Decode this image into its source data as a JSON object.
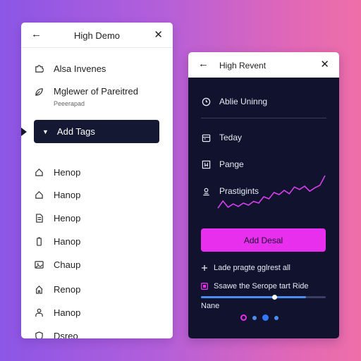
{
  "left_panel": {
    "title": "High Demo",
    "items": [
      {
        "label": "Alsa Invenes",
        "icon": "puzzle-icon"
      },
      {
        "label": "Mglewer of Pareitred",
        "sublabel": "Peeerapad",
        "icon": "leaf-icon"
      },
      {
        "label": "Add Tags",
        "icon": "caret-down-icon",
        "selected": true
      },
      {
        "label": "Henop",
        "icon": "house-icon"
      },
      {
        "label": "Hanop",
        "icon": "house-icon"
      },
      {
        "label": "Henop",
        "icon": "document-icon"
      },
      {
        "label": "Hanop",
        "icon": "battery-icon"
      },
      {
        "label": "Chaup",
        "icon": "image-icon"
      },
      {
        "label": "Renop",
        "icon": "home-outline-icon"
      },
      {
        "label": "Hanop",
        "icon": "person-icon"
      },
      {
        "label": "Dsreo",
        "icon": "shield-icon"
      }
    ]
  },
  "right_panel": {
    "title": "High Revent",
    "rows": [
      {
        "label": "Ablie Uninng",
        "icon": "clock-icon"
      },
      {
        "label": "Teday",
        "icon": "calendar-icon"
      },
      {
        "label": "Pange",
        "icon": "bookmark-icon"
      },
      {
        "label": "Prastigints",
        "icon": "user-icon"
      }
    ],
    "sparkline": [
      0.18,
      0.35,
      0.2,
      0.28,
      0.22,
      0.3,
      0.25,
      0.34,
      0.3,
      0.45,
      0.4,
      0.55,
      0.5,
      0.6,
      0.52,
      0.68,
      0.62,
      0.7,
      0.58,
      0.66,
      0.72,
      0.95
    ],
    "button_label": "Add Desal",
    "line1": "Lade pragte gglrest all",
    "line2": "Ssawe the Serope tart Ride",
    "slider_level": 0.84,
    "slider_label": "Nane",
    "dots": [
      "#e82fee",
      "#4a8ef0",
      "#2f7bff",
      "#4a8ef0"
    ]
  }
}
